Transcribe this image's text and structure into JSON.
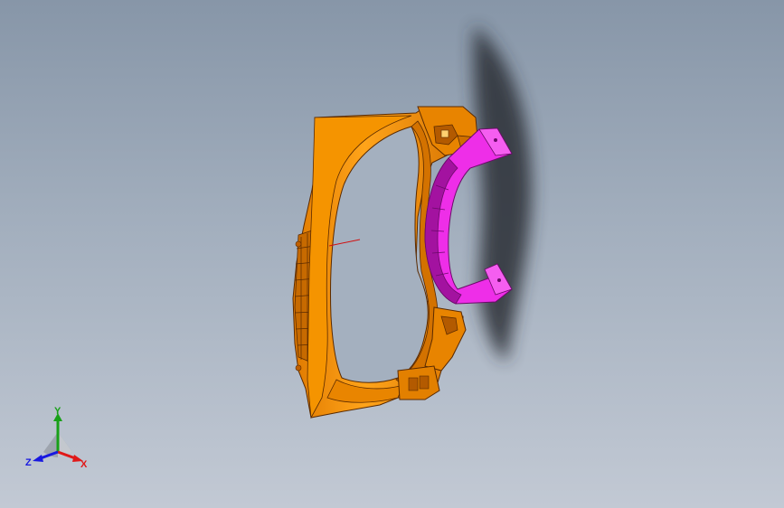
{
  "viewport": {
    "background_top": "#8796a8",
    "background_bottom": "#c2c9d4"
  },
  "model": {
    "part_color": "#f08c00",
    "part_shade": "#b85e00",
    "part_highlight": "#ffb52e",
    "inner_part_color": "#ee2ee8",
    "inner_part_shade": "#a312a0",
    "shadow_color": "#2a2e35"
  },
  "triad": {
    "x_label": "X",
    "y_label": "Y",
    "z_label": "Z",
    "x_color": "#e01818",
    "y_color": "#18a018",
    "z_color": "#1818e0"
  }
}
